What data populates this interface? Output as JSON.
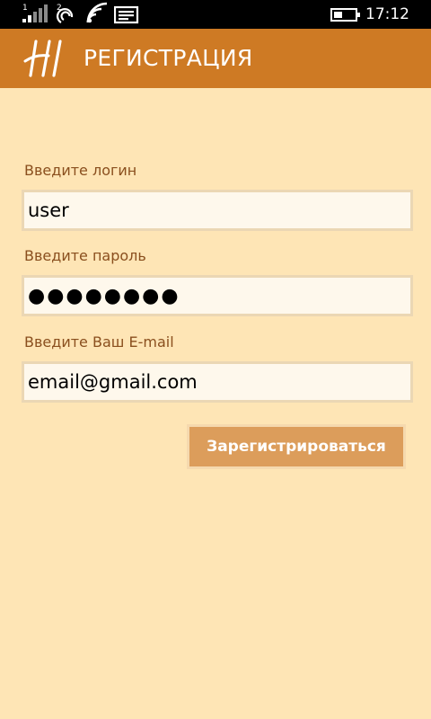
{
  "status_bar": {
    "icons": [
      "signal-strength-icon",
      "sim-card-icon",
      "wifi-icon",
      "message-icon",
      "battery-icon"
    ],
    "signal_sim_number": "1",
    "sim_slot_number": "2",
    "time": "17:12"
  },
  "header": {
    "logo_icon": "hi-logo-icon",
    "title": "РЕГИСТРАЦИЯ"
  },
  "form": {
    "login": {
      "label": "Введите логин",
      "value": "user"
    },
    "password": {
      "label": "Введите пароль",
      "value": "●●●●●●●●"
    },
    "email": {
      "label": "Введите Ваш E-mail",
      "value": "email@gmail.com"
    },
    "submit_label": "Зарегистрироваться"
  },
  "colors": {
    "background": "#fee5b5",
    "header": "#ce7a24",
    "label_text": "#8a4f1e",
    "field_background": "#fef8ec",
    "button_background": "#dc9d5b"
  }
}
